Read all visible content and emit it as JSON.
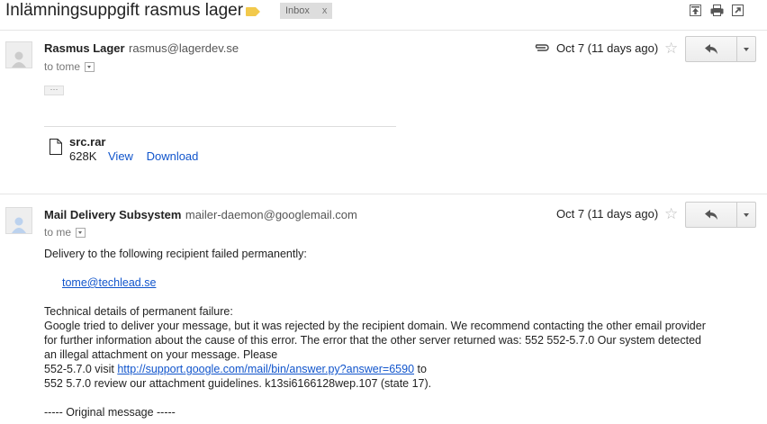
{
  "thread": {
    "subject": "Inlämningsuppgift rasmus lager",
    "label": "Inbox",
    "label_close": "x"
  },
  "messages": [
    {
      "sender_name": "Rasmus Lager",
      "sender_email": "rasmus@lagerdev.se",
      "to": "to tome",
      "date": "Oct 7 (11 days ago)",
      "trimmed_indicator": "···",
      "attachment": {
        "name": "src.rar",
        "size": "628K",
        "view_label": "View",
        "download_label": "Download"
      }
    },
    {
      "sender_name": "Mail Delivery Subsystem",
      "sender_email": "mailer-daemon@googlemail.com",
      "to": "to me",
      "date": "Oct 7 (11 days ago)",
      "body": {
        "line1": "Delivery to the following recipient failed permanently:",
        "recipient": "tome@techlead.se",
        "details_heading": "Technical details of permanent failure:",
        "p1": "Google tried to deliver your message, but it was rejected by the recipient domain. We recommend contacting the other email provider",
        "p2": "for further information about the cause of this error. The error that the other server returned was: 552 552-5.7.0 Our system detected",
        "p3": "an illegal attachment on your message. Please",
        "p4_prefix": "552-5.7.0 visit",
        "p4_link": "http://support.google.com/mail/bin/answer.py?answer=6590",
        "p4_suffix": "to",
        "p5": "552 5.7.0 review our attachment guidelines. k13si6166128wep.107 (state 17).",
        "original": "----- Original message -----"
      }
    }
  ],
  "icons": [
    "label-icon",
    "expand-all-icon",
    "print-icon",
    "new-window-icon",
    "avatar-icon",
    "paperclip-icon",
    "star-icon",
    "reply-icon",
    "more-options-icon",
    "file-icon",
    "show-details-icon"
  ],
  "colors": {
    "link": "#1155cc",
    "label_yellow": "#f2c94c",
    "chip": "#dddddd"
  }
}
